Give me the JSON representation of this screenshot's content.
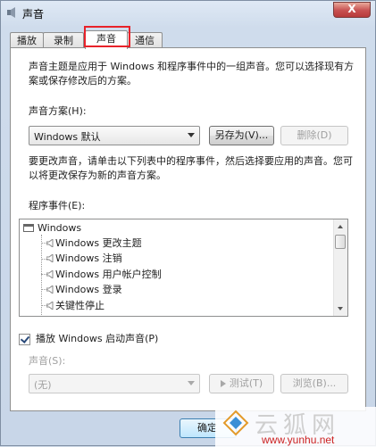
{
  "window": {
    "title": "声音",
    "close_symbol": "X"
  },
  "tabs": [
    {
      "label": "播放",
      "active": false
    },
    {
      "label": "录制",
      "active": false
    },
    {
      "label": "声音",
      "active": true
    },
    {
      "label": "通信",
      "active": false
    }
  ],
  "intro_text_line1": "声音主题是应用于 Windows 和程序事件中的一组声音。您可以选择现有方",
  "intro_text_line2": "案或保存修改后的方案。",
  "scheme": {
    "label": "声音方案(H):",
    "selected": "Windows 默认",
    "save_as_label": "另存为(V)...",
    "delete_label": "删除(D)"
  },
  "instruction_line1": "要更改声音，请单击以下列表中的程序事件，然后选择要应用的声音。您可",
  "instruction_line2": "以将更改保存为新的声音方案。",
  "events": {
    "label": "程序事件(E):",
    "group": "Windows",
    "items": [
      "Windows 更改主题",
      "Windows 注销",
      "Windows 用户帐户控制",
      "Windows 登录",
      "关键性停止"
    ]
  },
  "startup_sound": {
    "label": "播放 Windows 启动声音(P)",
    "checked": true
  },
  "sound": {
    "label": "声音(S):",
    "selected": "(无)",
    "test_label": "测试(T)",
    "browse_label": "浏览(B)..."
  },
  "ok_label": "确定",
  "watermark": {
    "chinese": "云狐网",
    "url": "www.yunhu.net"
  },
  "colors": {
    "highlight": "#e8222a",
    "titlebar": "#cfdcec"
  }
}
